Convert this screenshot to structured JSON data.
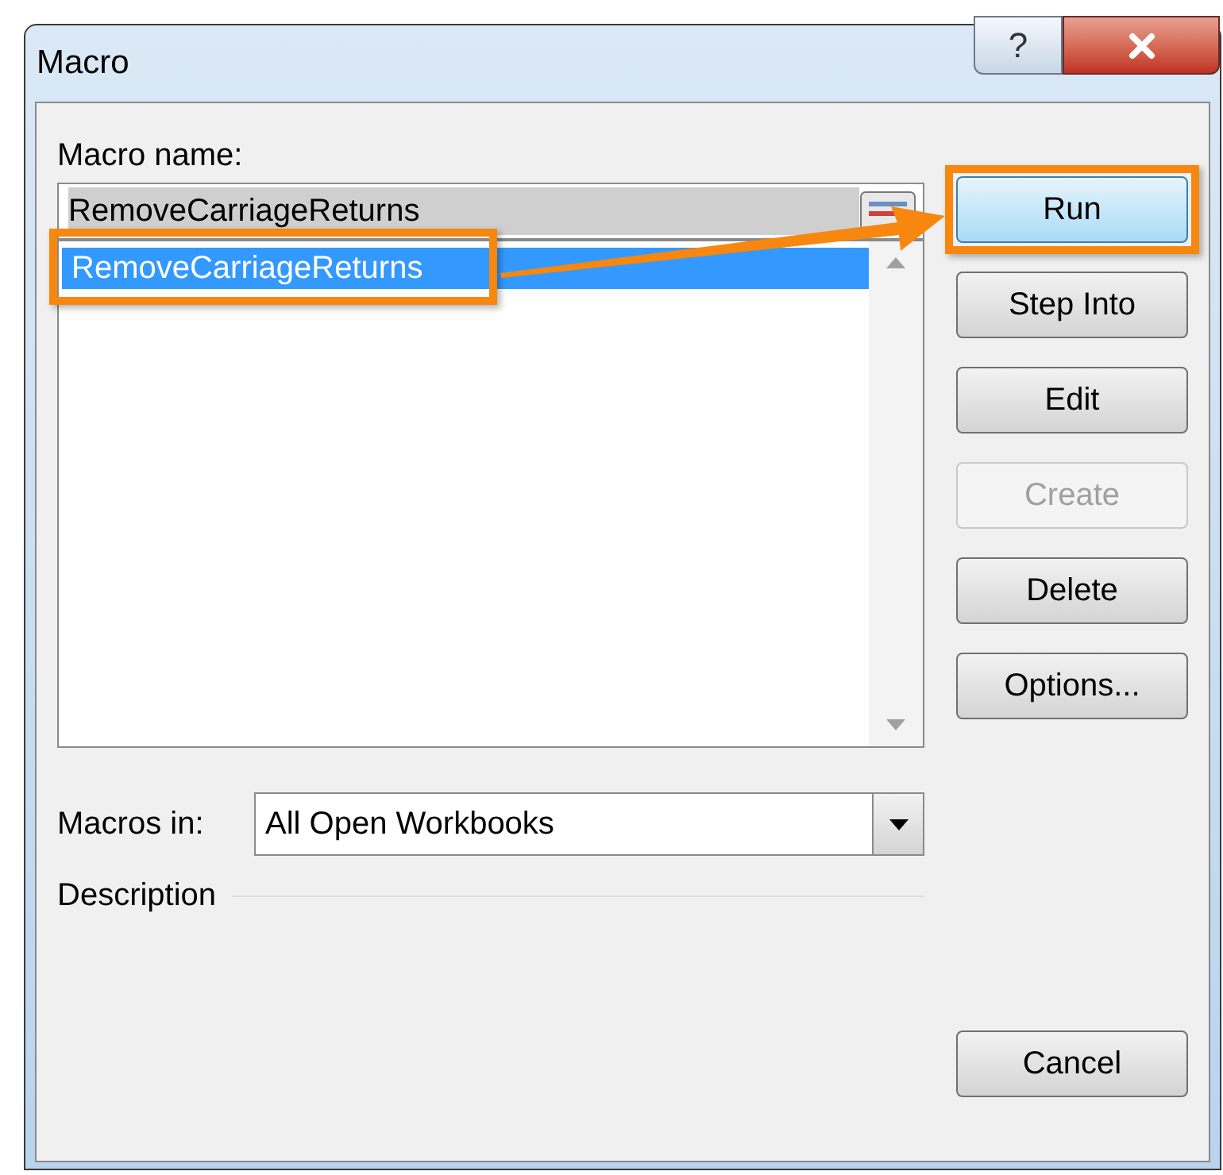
{
  "window": {
    "title": "Macro",
    "help_button": "?"
  },
  "macro_name": {
    "label": "Macro name:",
    "value": "RemoveCarriageReturns"
  },
  "macro_list": {
    "items": [
      {
        "label": "RemoveCarriageReturns",
        "selected": true
      }
    ]
  },
  "buttons": [
    {
      "label": "Run",
      "disabled": false,
      "highlighted": true
    },
    {
      "label": "Step Into",
      "disabled": false,
      "highlighted": false
    },
    {
      "label": "Edit",
      "disabled": false,
      "highlighted": false
    },
    {
      "label": "Create",
      "disabled": true,
      "highlighted": false
    },
    {
      "label": "Delete",
      "disabled": false,
      "highlighted": false
    },
    {
      "label": "Options...",
      "disabled": false,
      "highlighted": false
    }
  ],
  "macros_in": {
    "label": "Macros in:",
    "value": "All Open Workbooks"
  },
  "description": {
    "label": "Description"
  },
  "cancel_button": "Cancel"
}
